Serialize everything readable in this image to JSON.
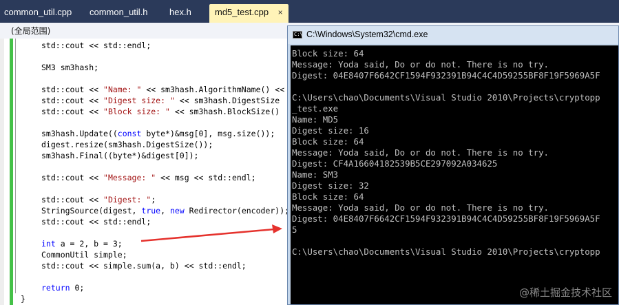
{
  "tabs": [
    {
      "label": "common_util.cpp"
    },
    {
      "label": "common_util.h"
    },
    {
      "label": "hex.h"
    },
    {
      "label": "md5_test.cpp",
      "active": true
    }
  ],
  "tab_close_glyph": "×",
  "scope_label": "(全局范围)",
  "editor": {
    "lines": [
      "std::cout << std::endl;",
      "",
      "SM3 sm3hash;",
      "",
      "std::cout << \"Name: \" << sm3hash.AlgorithmName() <<",
      "std::cout << \"Digest size: \" << sm3hash.DigestSize",
      "std::cout << \"Block size: \" << sm3hash.BlockSize()",
      "",
      "sm3hash.Update((const byte*)&msg[0], msg.size());",
      "digest.resize(sm3hash.DigestSize());",
      "sm3hash.Final((byte*)&digest[0]);",
      "",
      "std::cout << \"Message: \" << msg << std::endl;",
      "",
      "std::cout << \"Digest: \";",
      "StringSource(digest, true, new Redirector(encoder));",
      "std::cout << std::endl;",
      "",
      "int a = 2, b = 3;",
      "CommonUtil simple;",
      "std::cout << simple.sum(a, b) << std::endl;",
      "",
      "return 0;",
      "}"
    ]
  },
  "console": {
    "title": "C:\\Windows\\System32\\cmd.exe",
    "icon": "cmd-icon",
    "lines": [
      "Block size: 64",
      "Message: Yoda said, Do or do not. There is no try.",
      "Digest: 04E8407F6642CF1594F932391B94C4C4D59255BF8F19F5969A5F",
      "",
      "C:\\Users\\chao\\Documents\\Visual Studio 2010\\Projects\\cryptopp",
      "_test.exe",
      "Name: MD5",
      "Digest size: 16",
      "Block size: 64",
      "Message: Yoda said, Do or do not. There is no try.",
      "Digest: CF4A16604182539B5CE297092A034625",
      "Name: SM3",
      "Digest size: 32",
      "Block size: 64",
      "Message: Yoda said, Do or do not. There is no try.",
      "Digest: 04E8407F6642CF1594F932391B94C4C4D59255BF8F19F5969A5F",
      "5",
      "",
      "C:\\Users\\chao\\Documents\\Visual Studio 2010\\Projects\\cryptopp"
    ]
  },
  "annotation": {
    "arrow_color": "#e5322d"
  },
  "watermark": "@稀土掘金技术社区"
}
